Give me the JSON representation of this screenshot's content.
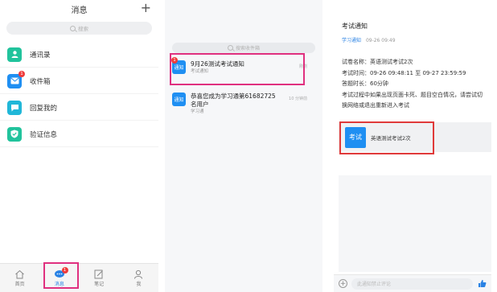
{
  "panel1": {
    "title": "消息",
    "plus_glyph": "+",
    "search_placeholder": "搜索",
    "items": [
      {
        "label": "通讯录",
        "icon": "contacts-icon",
        "color": "#21c39c",
        "badge": ""
      },
      {
        "label": "收件箱",
        "icon": "inbox-icon",
        "color": "#1f8ff2",
        "badge": "1"
      },
      {
        "label": "回复我的",
        "icon": "reply-icon",
        "color": "#20b7d8",
        "badge": ""
      },
      {
        "label": "验证信息",
        "icon": "shield-check-icon",
        "color": "#21c39c",
        "badge": ""
      }
    ],
    "tabs": [
      {
        "label": "首页",
        "icon": "home-icon",
        "active": false
      },
      {
        "label": "消息",
        "icon": "chat-icon",
        "active": true,
        "badge": "1"
      },
      {
        "label": "笔记",
        "icon": "note-icon",
        "active": false
      },
      {
        "label": "我",
        "icon": "person-icon",
        "active": false
      }
    ]
  },
  "panel2": {
    "search_placeholder": "搜索收件箱",
    "messages": [
      {
        "icon_label": "通知",
        "title": "9月26测试考试通知",
        "sub": "考试通知",
        "time": "刚刚",
        "badge": "1"
      },
      {
        "icon_label": "通知",
        "title": "恭喜您成为学习通第61682725名用户",
        "sub": "学习通",
        "time": "10 分钟前",
        "badge": ""
      }
    ]
  },
  "panel3": {
    "title": "考试通知",
    "sender": "学习通知",
    "date": "09-26 09:49",
    "lines": [
      "试卷名称：英语测试考试2次",
      "考试时间：09-26 09:48:11 至 09-27 23:59:59",
      "答题时长：60分钟",
      "考试过程中如果出现页面卡死、题目空白情况，请尝试切换网络或退出重新进入考试"
    ],
    "card": {
      "icon_label": "考试",
      "label": "英语测试考试2次"
    },
    "input_placeholder": "此通知禁止评论",
    "plus_glyph": "+"
  },
  "colors": {
    "accent": "#1f8ff2",
    "highlight": "#e0307f",
    "box_red": "#e03a3a"
  }
}
